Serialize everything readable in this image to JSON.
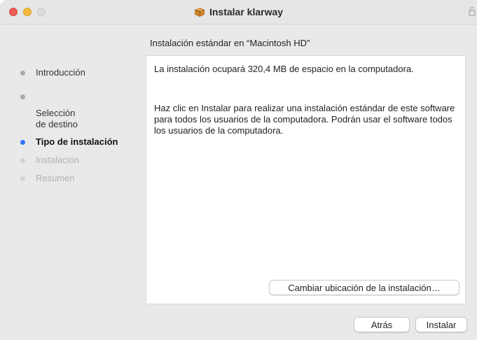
{
  "window": {
    "title": "Instalar klarway",
    "icon": "package-icon"
  },
  "header": {
    "subtitle": "Instalación estándar en “Macintosh HD”"
  },
  "sidebar": {
    "steps": [
      {
        "label": "Introducción",
        "state": "done"
      },
      {
        "label": "Selección\nde destino",
        "state": "done"
      },
      {
        "label": "Tipo de instalación",
        "state": "current"
      },
      {
        "label": "Instalación",
        "state": "future"
      },
      {
        "label": "Resumen",
        "state": "future"
      }
    ],
    "colors": {
      "current": "#2f74f6",
      "done": "#a8a8a8",
      "future": "#d3d3d3"
    }
  },
  "content": {
    "paragraph1": "La instalación ocupará 320,4 MB de espacio en la computadora.",
    "paragraph2": "Haz clic en Instalar para realizar una instalación estándar de este software para todos los usuarios de la computadora. Podrán usar el software todos los usuarios de la computadora.",
    "change_location_label": "Cambiar ubicación de la instalación…"
  },
  "footer": {
    "back_label": "Atrás",
    "install_label": "Instalar"
  }
}
